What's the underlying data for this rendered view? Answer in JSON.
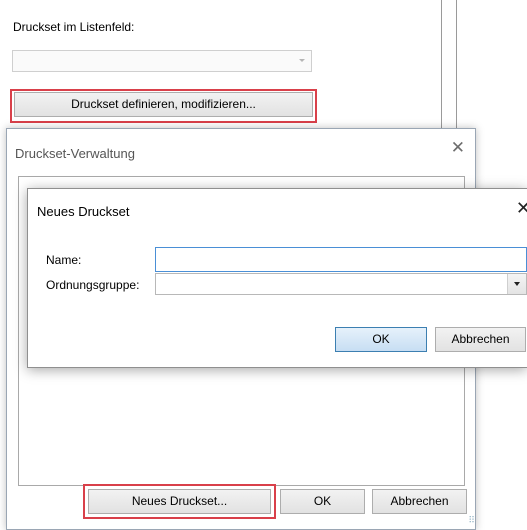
{
  "background": {
    "label": "Druckset im Listenfeld:",
    "listbox_value": "",
    "define_button": "Druckset definieren, modifizieren..."
  },
  "dialog_main": {
    "title": "Druckset-Verwaltung",
    "close_icon": "close-icon",
    "new_button": "Neues Druckset...",
    "ok_button": "OK",
    "cancel_button": "Abbrechen"
  },
  "dialog_new": {
    "title": "Neues Druckset",
    "close_icon": "close-icon",
    "name_label": "Name:",
    "name_value": "",
    "group_label": "Ordnungsgruppe:",
    "group_value": "",
    "ok_button": "OK",
    "cancel_button": "Abbrechen"
  },
  "colors": {
    "highlight": "#d9404a",
    "focus_border": "#4a8fd6"
  }
}
